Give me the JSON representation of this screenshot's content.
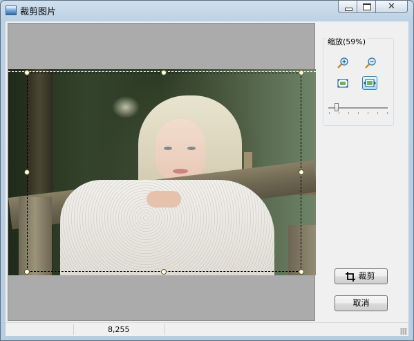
{
  "window": {
    "title": "裁剪图片"
  },
  "zoom": {
    "label": "缩放(59%)",
    "percent": 59
  },
  "tools": {
    "zoom_in": "zoom-in-icon",
    "zoom_out": "zoom-out-icon",
    "fit_window": "fit-window-icon",
    "actual_size": "fit-width-icon"
  },
  "buttons": {
    "crop": "裁剪",
    "cancel": "取消"
  },
  "status": {
    "value": "8,255"
  },
  "colors": {
    "handle": "#ffffc8",
    "accent": "#3c7fb1"
  }
}
